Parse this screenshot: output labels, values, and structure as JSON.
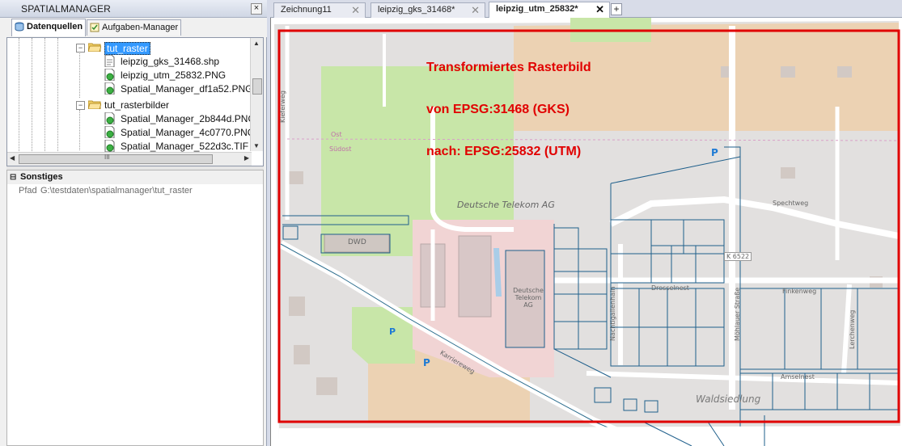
{
  "palette": {
    "title": "SPATIALMANAGER",
    "close_glyph": "×",
    "tabs": [
      {
        "label": "Datenquellen",
        "icon": "database-icon",
        "active": true
      },
      {
        "label": "Aufgaben-Manager",
        "icon": "task-list-icon",
        "active": false
      }
    ],
    "tree": [
      {
        "label": "tut_raster",
        "type": "folder",
        "expander": "−",
        "selected": true
      },
      {
        "label": "leipzig_gks_31468.shp",
        "type": "shp-file"
      },
      {
        "label": "leipzig_utm_25832.PNG",
        "type": "raster-file"
      },
      {
        "label": "Spatial_Manager_df1a52.PNG",
        "type": "raster-file"
      },
      {
        "label": "tut_rasterbilder",
        "type": "folder",
        "expander": "−"
      },
      {
        "label": "Spatial_Manager_2b844d.PNG",
        "type": "raster-file"
      },
      {
        "label": "Spatial_Manager_4c0770.PNG",
        "type": "raster-file"
      },
      {
        "label": "Spatial_Manager_522d3c.TIF",
        "type": "raster-file"
      }
    ],
    "hscroll_grip": "III",
    "properties": {
      "category": "Sonstiges",
      "rows": [
        {
          "key": "Pfad",
          "value": "G:\\testdaten\\spatialmanager\\tut_raster"
        }
      ]
    }
  },
  "doc_tabs": [
    {
      "label": "Zeichnung11",
      "close": "✕",
      "active": false
    },
    {
      "label": "leipzig_gks_31468*",
      "close": "✕",
      "active": false
    },
    {
      "label": "leipzig_utm_25832*",
      "close": "✕",
      "active": true
    }
  ],
  "add_tab_glyph": "+",
  "map": {
    "street_labels": [
      "Kieferweg",
      "Spechtweg",
      "Finkenweg",
      "Drosselnest",
      "Nachtigallenhain",
      "Möhlauer Straße",
      "Lerchenweg",
      "Amselnest",
      "Karriereweg",
      "K 6522"
    ],
    "landmarks": [
      "DWD",
      "Deutsche Telekom AG",
      "Deutsche Telekom AG",
      "Ost",
      "Südost",
      "Waldsiedlung",
      "P",
      "P",
      "P"
    ],
    "annotations": [
      "Transformiertes Rasterbild",
      "von EPSG:31468 (GKS)",
      "nach: EPSG:25832 (UTM)"
    ],
    "colors": {
      "frame": "#e00000",
      "annotation": "#e10000",
      "vector": "#1f5f8b",
      "park": "#c8e6a8",
      "telekom": "#f2d5d5",
      "farmland": "#e8c8a0"
    }
  }
}
